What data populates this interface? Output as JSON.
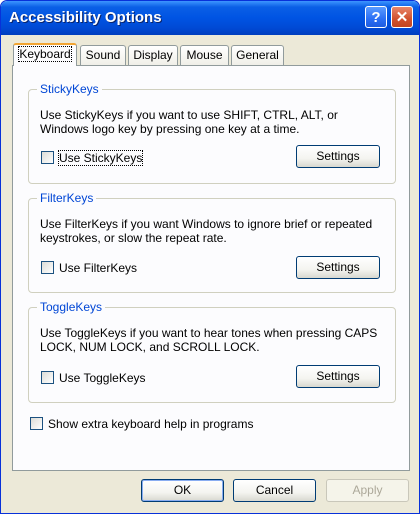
{
  "window": {
    "title": "Accessibility Options"
  },
  "titlebar": {
    "help_glyph": "?",
    "close_glyph": "✕"
  },
  "tabs": [
    {
      "label": "Keyboard",
      "active": true
    },
    {
      "label": "Sound",
      "active": false
    },
    {
      "label": "Display",
      "active": false
    },
    {
      "label": "Mouse",
      "active": false
    },
    {
      "label": "General",
      "active": false
    }
  ],
  "sticky": {
    "title": "StickyKeys",
    "description": "Use StickyKeys if you want to use SHIFT, CTRL, ALT, or Windows logo key by pressing one key at a time.",
    "checkbox_label": "Use StickyKeys",
    "checked": false,
    "settings_label": "Settings"
  },
  "filter": {
    "title": "FilterKeys",
    "description": "Use FilterKeys if you want Windows to ignore brief or repeated keystrokes, or slow the repeat rate.",
    "checkbox_label": "Use FilterKeys",
    "checked": false,
    "settings_label": "Settings"
  },
  "toggle": {
    "title": "ToggleKeys",
    "description": "Use ToggleKeys if you want to hear tones when pressing CAPS LOCK, NUM LOCK, and SCROLL LOCK.",
    "checkbox_label": "Use ToggleKeys",
    "checked": false,
    "settings_label": "Settings"
  },
  "extra_help": {
    "label": "Show extra keyboard help in programs",
    "checked": false
  },
  "footer": {
    "ok_label": "OK",
    "cancel_label": "Cancel",
    "apply_label": "Apply"
  },
  "colors": {
    "titlebar": "#0054e3",
    "group_title": "#0046d5",
    "tab_highlight": "#f2a533",
    "dialog_bg": "#ece9d8"
  }
}
